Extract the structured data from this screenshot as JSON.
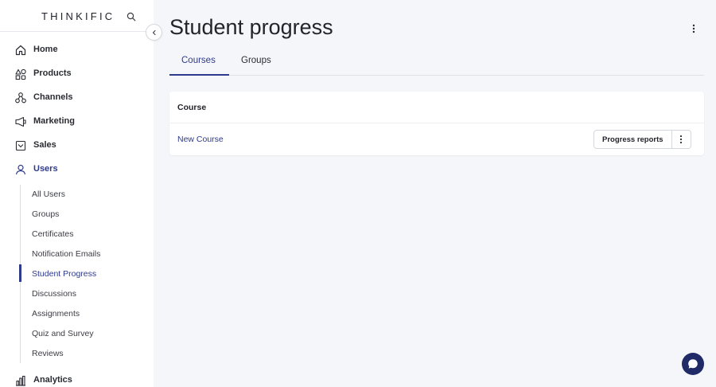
{
  "brand": {
    "name": "THINKIFIC"
  },
  "sidebar": {
    "items": [
      {
        "label": "Home",
        "icon": "home-icon"
      },
      {
        "label": "Products",
        "icon": "products-icon"
      },
      {
        "label": "Channels",
        "icon": "channels-icon"
      },
      {
        "label": "Marketing",
        "icon": "megaphone-icon"
      },
      {
        "label": "Sales",
        "icon": "sales-icon"
      },
      {
        "label": "Users",
        "icon": "user-icon",
        "active": true
      },
      {
        "label": "Analytics",
        "icon": "analytics-icon"
      }
    ],
    "sub_items": [
      {
        "label": "All Users"
      },
      {
        "label": "Groups"
      },
      {
        "label": "Certificates"
      },
      {
        "label": "Notification Emails"
      },
      {
        "label": "Student Progress",
        "active": true
      },
      {
        "label": "Discussions"
      },
      {
        "label": "Assignments"
      },
      {
        "label": "Quiz and Survey"
      },
      {
        "label": "Reviews"
      }
    ]
  },
  "main": {
    "title": "Student progress",
    "tabs": [
      {
        "label": "Courses",
        "active": true
      },
      {
        "label": "Groups"
      }
    ],
    "table": {
      "header": "Course",
      "rows": [
        {
          "course": "New Course",
          "action_label": "Progress reports"
        }
      ]
    }
  },
  "colors": {
    "accent": "#2e3a8c",
    "chat_button": "#1f2a66",
    "background": "#f5f6fa"
  }
}
